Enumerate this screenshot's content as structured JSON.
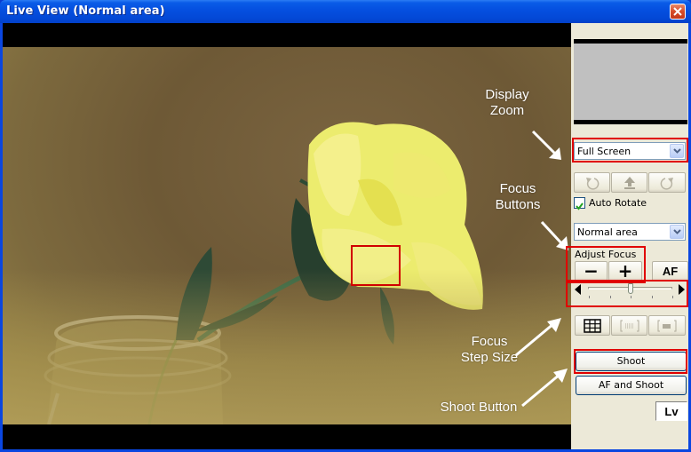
{
  "window": {
    "title": "Live View (Normal area)"
  },
  "annotations": {
    "display_zoom": [
      "Display",
      "Zoom"
    ],
    "focus_buttons": [
      "Focus",
      "Buttons"
    ],
    "focus_step_size": [
      "Focus",
      "Step Size"
    ],
    "shoot_button": "Shoot Button"
  },
  "panel": {
    "display_zoom_select": {
      "value": "Full Screen"
    },
    "rotate_buttons": [
      "rotate-left",
      "upload",
      "rotate-right"
    ],
    "auto_rotate": {
      "label": "Auto Rotate",
      "checked": true
    },
    "area_select": {
      "value": "Normal area"
    },
    "adjust_focus": {
      "label": "Adjust Focus",
      "minus": "−",
      "plus": "+",
      "af": "AF"
    },
    "focus_step_slider": {
      "position": 0.5,
      "ticks": 5
    },
    "grid_buttons": [
      "grid",
      "focus-frame",
      "white-balance-frame"
    ],
    "shoot_label": "Shoot",
    "af_shoot_label": "AF and Shoot",
    "lv_label": "Lv"
  },
  "colors": {
    "highlight_red": "#e00000",
    "titlebar_blue": "#0550e0"
  }
}
